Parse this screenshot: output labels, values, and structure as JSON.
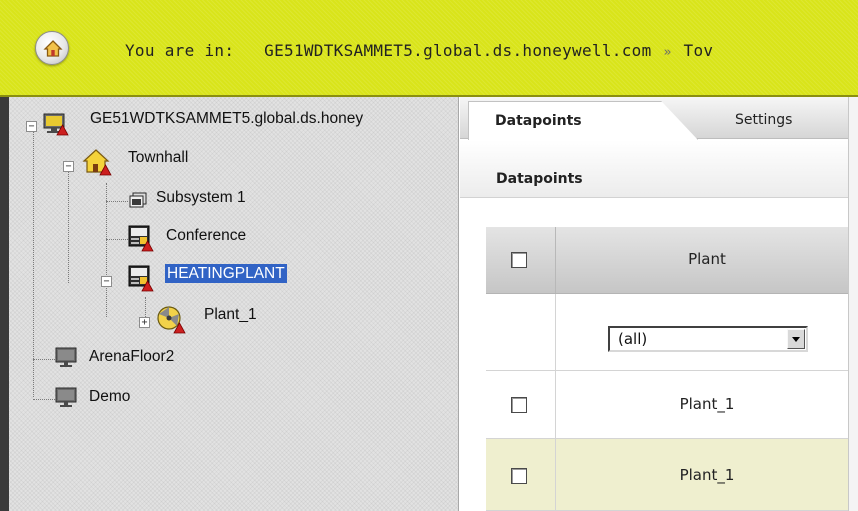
{
  "header": {
    "location_prefix": "You are in:",
    "breadcrumb_host": "GE51WDTKSAMMET5.global.ds.honeywell.com",
    "breadcrumb_separator": "»",
    "breadcrumb_next": "Tov"
  },
  "tree": {
    "items": [
      {
        "label": "GE51WDTKSAMMET5.global.ds.honey",
        "icon": "server-alarm-icon"
      },
      {
        "label": "Townhall",
        "icon": "building-alarm-icon"
      },
      {
        "label": "Subsystem 1",
        "icon": "subsystem-icon"
      },
      {
        "label": "Conference",
        "icon": "panel-alarm-icon"
      },
      {
        "label": "HEATINGPLANT",
        "icon": "panel-alarm-icon",
        "selected": true
      },
      {
        "label": "Plant_1",
        "icon": "plant-alarm-icon"
      },
      {
        "label": "ArenaFloor2",
        "icon": "monitor-icon"
      },
      {
        "label": "Demo",
        "icon": "monitor-icon"
      }
    ]
  },
  "tabs": {
    "datapoints": "Datapoints",
    "settings": "Settings"
  },
  "section": {
    "title": "Datapoints"
  },
  "grid": {
    "column_plant": "Plant",
    "filter_value": "(all)",
    "rows": [
      {
        "plant": "Plant_1"
      },
      {
        "plant": "Plant_1"
      }
    ]
  },
  "colors": {
    "header_bar": "#d9e41a",
    "selection": "#3163c5",
    "alt_row": "#efefcf"
  }
}
